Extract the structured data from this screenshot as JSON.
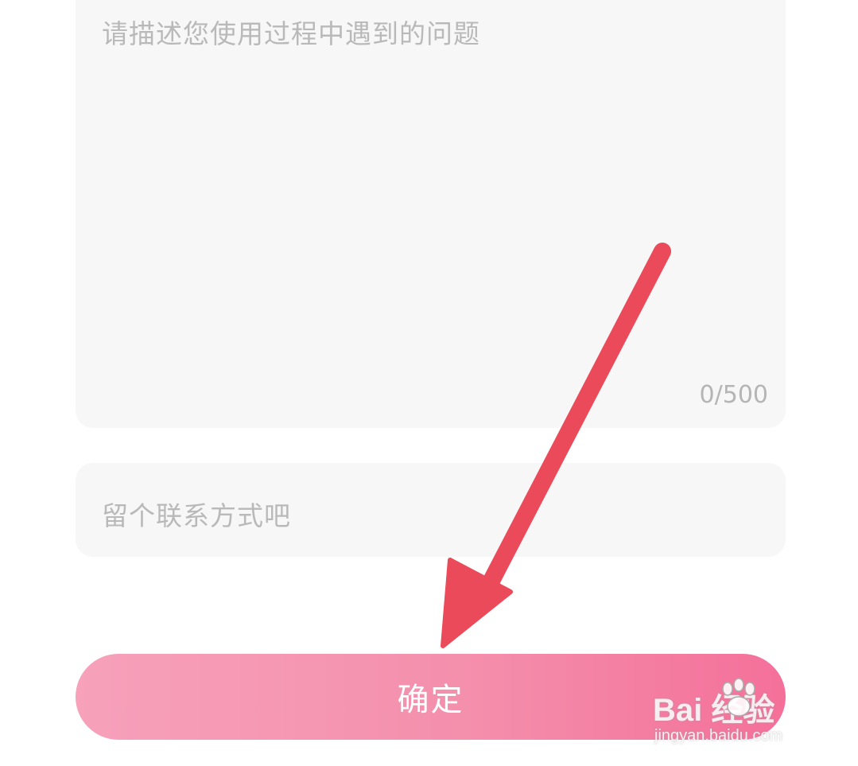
{
  "form": {
    "description_placeholder": "请描述您使用过程中遇到的问题",
    "description_counter": "0/500",
    "contact_placeholder": "留个联系方式吧",
    "confirm_label": "确定"
  },
  "annotation": {
    "arrow_color": "#ea4a59"
  },
  "watermark": {
    "brand": "Bai  经验",
    "subtext": "jingyan.baidu.com"
  },
  "colors": {
    "field_background": "#f7f7f7",
    "placeholder": "#b9b9b9",
    "button_gradient_start": "#f7a1bb",
    "button_gradient_end": "#f4709a"
  }
}
